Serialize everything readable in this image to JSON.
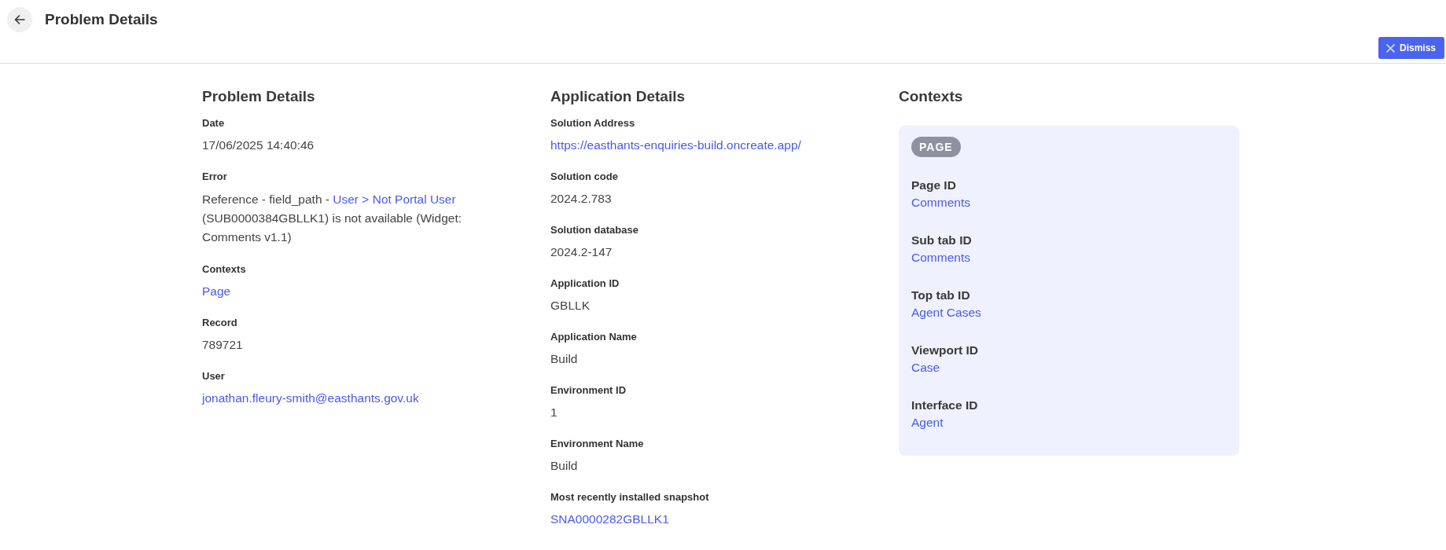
{
  "header": {
    "title": "Problem Details"
  },
  "dismiss_button": {
    "label": "Dismiss"
  },
  "sections": [
    {
      "title": "Problem Details",
      "fields": [
        {
          "label": "Date",
          "kind": "text",
          "value": "17/06/2025 14:40:46"
        },
        {
          "label": "Error",
          "kind": "mixed",
          "parts": [
            {
              "kind": "text",
              "text": "Reference - field_path - "
            },
            {
              "kind": "link",
              "text": "User > Not Portal User"
            },
            {
              "kind": "text",
              "text": " (SUB0000384GBLLK1) is not available (Widget: Comments v1.1)"
            }
          ]
        },
        {
          "label": "Contexts",
          "kind": "link",
          "value": "Page"
        },
        {
          "label": "Record",
          "kind": "text",
          "value": "789721"
        },
        {
          "label": "User",
          "kind": "link",
          "value": "jonathan.fleury-smith@easthants.gov.uk"
        }
      ]
    },
    {
      "title": "Application Details",
      "fields": [
        {
          "label": "Solution Address",
          "kind": "link",
          "value": "https://easthants-enquiries-build.oncreate.app/"
        },
        {
          "label": "Solution code",
          "kind": "text",
          "value": "2024.2.783"
        },
        {
          "label": "Solution database",
          "kind": "text",
          "value": "2024.2-147"
        },
        {
          "label": "Application ID",
          "kind": "text",
          "value": "GBLLK"
        },
        {
          "label": "Application Name",
          "kind": "text",
          "value": "Build"
        },
        {
          "label": "Environment ID",
          "kind": "text",
          "value": "1"
        },
        {
          "label": "Environment Name",
          "kind": "text",
          "value": "Build"
        },
        {
          "label": "Most recently installed snapshot",
          "kind": "link",
          "value": "SNA0000282GBLLK1"
        }
      ]
    }
  ],
  "contexts": {
    "title": "Contexts",
    "badge": "PAGE",
    "fields": [
      {
        "label": "Page ID",
        "value": "Comments"
      },
      {
        "label": "Sub tab ID",
        "value": "Comments"
      },
      {
        "label": "Top tab ID",
        "value": "Agent Cases"
      },
      {
        "label": "Viewport ID",
        "value": "Case"
      },
      {
        "label": "Interface ID",
        "value": "Agent"
      }
    ]
  }
}
